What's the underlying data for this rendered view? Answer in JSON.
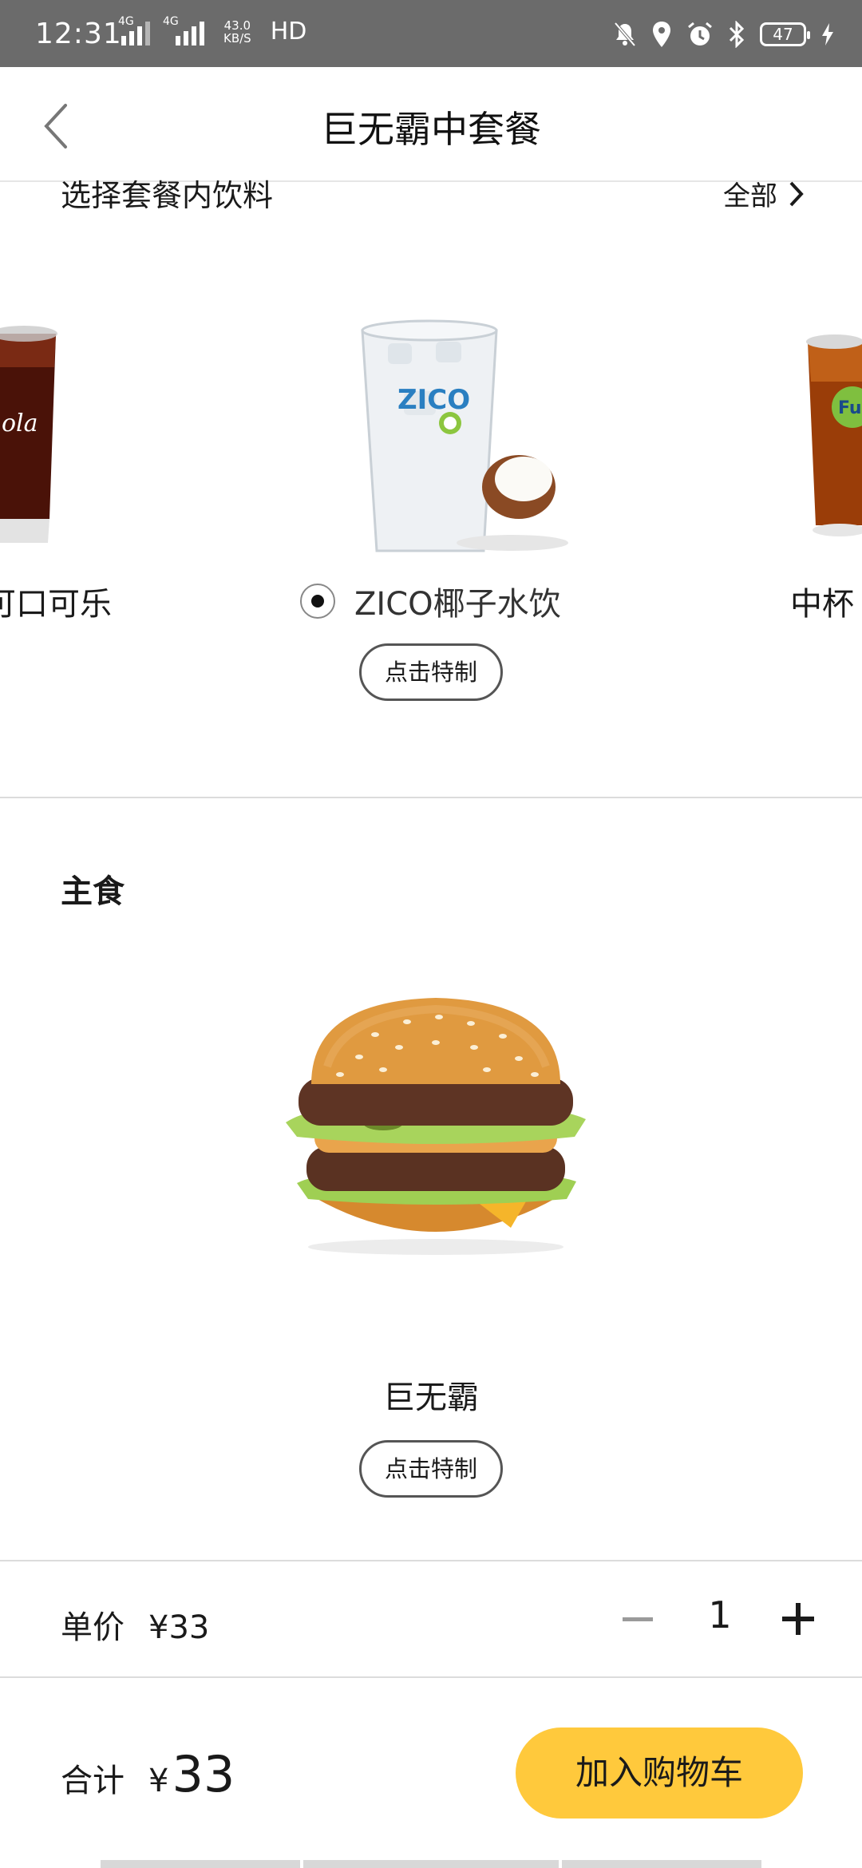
{
  "status_bar": {
    "time": "12:31",
    "network_1": "4G",
    "network_2": "4G",
    "speed": "43.0",
    "speed_unit": "KB/S",
    "hd": "HD",
    "battery": "47"
  },
  "header": {
    "title": "巨无霸中套餐"
  },
  "drinks": {
    "section_title": "选择套餐内饮料",
    "all_label": "全部",
    "items": [
      {
        "name": "可口可乐",
        "selected": false
      },
      {
        "name": "ZICO椰子水饮",
        "selected": true
      },
      {
        "name": "中杯",
        "selected": false
      }
    ],
    "customize_label": "点击特制"
  },
  "main_course": {
    "section_title": "主食",
    "item_name": "巨无霸",
    "customize_label": "点击特制"
  },
  "unit_price": {
    "label": "单价",
    "value": "¥33"
  },
  "quantity": {
    "value": "1"
  },
  "total": {
    "label": "合计",
    "currency": "¥",
    "value": "33"
  },
  "cart_button": {
    "label": "加入购物车"
  },
  "colors": {
    "accent": "#ffc93c",
    "status_bar": "#6b6b6b"
  }
}
